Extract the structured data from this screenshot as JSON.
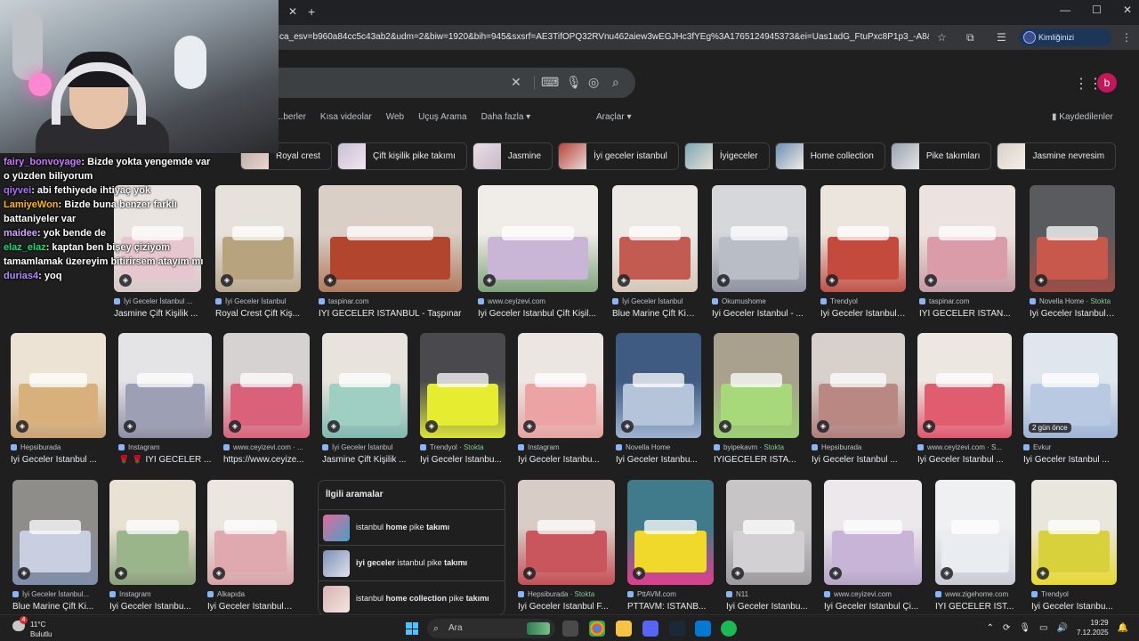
{
  "browser": {
    "url": "ca_esv=b960a84cc5c43ab2&udm=2&biw=1920&bih=945&sxsrf=AE3TifOPQ32RVnu462aiew3wEGJHc3fYEg%3A1765124945373&ei=Uas1adG_FtuPxc8P1p3_-A8&ved=0ahUKEw...",
    "profile_label": "Kimliğinizi doğrulayın",
    "window_controls": [
      "—",
      "☐",
      "✕"
    ]
  },
  "search": {
    "avatar_letter": "b"
  },
  "nav": {
    "tabs": [
      "...berler",
      "Kısa videolar",
      "Web",
      "Uçuş Arama",
      "Daha fazla ▾"
    ],
    "tools": "Araçlar ▾",
    "saved": "Kaydedilenler"
  },
  "chips": [
    "Royal crest",
    "Çift kişilik pike takımı",
    "Jasmine",
    "İyi geceler istanbul",
    "İyigeceler",
    "Home collection",
    "Pike takımları",
    "Jasmine nevresim"
  ],
  "row1": [
    {
      "src": "İyi Geceler İstanbul ...",
      "title": "Royal Crest Çift Kiş...",
      "c1": "#e8e6e3",
      "c2": "#c9b8a5",
      "bed": "#f2eee8"
    },
    {
      "src": "İyi Geceler İstanbul ...",
      "title": "Jasmine Çift Kişilik ...",
      "c1": "#e9e4e0",
      "c2": "#d8c9c9",
      "bed": "#e7c7cf"
    },
    {
      "src": "İyi Geceler İstanbul",
      "title": "Royal Crest Çift Kiş...",
      "c1": "#e6e1da",
      "c2": "#b9a98f",
      "bed": "#b7a37d"
    },
    {
      "src": "taspinar.com",
      "title": "İYİ GECELER İSTANBUL - Taşpınar",
      "c1": "#d9cfc6",
      "c2": "#b27a5e",
      "bed": "#b2452e"
    },
    {
      "src": "www.ceyizevi.com",
      "title": "İyi Geceler İstanbul Çift Kişil...",
      "c1": "#f0ece8",
      "c2": "#7da37a",
      "bed": "#c9b6d6"
    },
    {
      "src": "İyi Geceler İstanbul",
      "title": "Blue Marine Çift Kiş...",
      "c1": "#ece8e4",
      "c2": "#d6c7b8",
      "bed": "#c25b52"
    },
    {
      "src": "Okumushome",
      "title": "İyi Geceler İstanbul - ...",
      "c1": "#d5d7db",
      "c2": "#8f93a0",
      "bed": "#b9bdc6"
    },
    {
      "src": "Trendyol",
      "title": "İyi Geceler İstanbul ...",
      "c1": "#ebe5dd",
      "c2": "#c0524a",
      "bed": "#c44a3d"
    },
    {
      "src": "taspinar.com",
      "title": "İYİ GECELER İSTAN...",
      "c1": "#ece3e0",
      "c2": "#c69aa3",
      "bed": "#d99ca8"
    },
    {
      "src": "Novella Home · ",
      "stock": "Stokta",
      "title": "İyi Geceler İstanbul ...",
      "c1": "#5a5b5e",
      "c2": "#9c4e47",
      "bed": "#c8574c"
    }
  ],
  "row2": [
    {
      "src": "Hepsiburada",
      "title": "İyi Geceler İstanbul ...",
      "c1": "#ede3d4",
      "c2": "#caa273",
      "bed": "#d7b07c"
    },
    {
      "src": "Instagram",
      "title": "🌹 🌹 İYİ GECELER ...",
      "c1": "#e4e3e6",
      "c2": "#8e8fa3",
      "bed": "#9d9fb5"
    },
    {
      "src": "www.ceyizevi.com · ...",
      "title": "https://www.ceyize...",
      "c1": "#d6d2d2",
      "c2": "#d9647a",
      "bed": "#d9617a"
    },
    {
      "src": "İyi Geceler İstanbul",
      "title": "Jasmine Çift Kişilik ...",
      "c1": "#e8e3dd",
      "c2": "#7fb8b0",
      "bed": "#9fcfc3"
    },
    {
      "src": "Trendyol · ",
      "stock": "Stokta",
      "title": "İyi Geceler İstanbu...",
      "c1": "#4a4a4e",
      "c2": "#d9e43a",
      "bed": "#e6ec2f"
    },
    {
      "src": "Instagram",
      "title": "İyi Geceler İstanbu...",
      "c1": "#ece6e2",
      "c2": "#e6a3a0",
      "bed": "#eba4a3"
    },
    {
      "src": "Novella Home",
      "title": "İyi Geceler İstanbu...",
      "c1": "#3f5b82",
      "c2": "#9fb3cf",
      "bed": "#b6c4da"
    },
    {
      "src": "byipekavm · ",
      "stock": "Stokta",
      "title": "İYİGECELER İSTA...",
      "c1": "#a9a08d",
      "c2": "#9ccf74",
      "bed": "#a7d97b"
    },
    {
      "src": "Hepsiburada",
      "title": "İyi Geceler İstanbul ...",
      "c1": "#d8d0ca",
      "c2": "#b07f7a",
      "bed": "#b98883"
    },
    {
      "src": "www.ceyizevi.com · S...",
      "title": "İyi Geceler İstanbul ...",
      "c1": "#ece8e1",
      "c2": "#e0586e",
      "bed": "#df5d6f"
    },
    {
      "src": "Evkur",
      "title": "İyi Geceler İstanbul ...",
      "badge": "2 gün önce",
      "c1": "#dfe6ee",
      "c2": "#9fb4d4",
      "bed": "#b9c9e2"
    }
  ],
  "row3": [
    {
      "src": "İyi Geceler İstanbul...",
      "title": "Blue Marine Çift Ki...",
      "c1": "#8f8d8a",
      "c2": "#7f8eaa",
      "bed": "#c9cfe0"
    },
    {
      "src": "Instagram",
      "title": "İyi Geceler İstanbu...",
      "c1": "#e9e1d3",
      "c2": "#8aa07a",
      "bed": "#9ab58a"
    },
    {
      "src": "Alkapıda",
      "title": "İyi Geceler İstanbul Çi...",
      "c1": "#ebe6e0",
      "c2": "#d7a3a8",
      "bed": "#e0a9b0"
    },
    {
      "src": "Hepsiburada · ",
      "stock": "Stokta",
      "title": "İyi Geceler İstanbul F...",
      "c1": "#d8cdc6",
      "c2": "#c44f57",
      "bed": "#c8565c"
    },
    {
      "src": "PttAVM.com",
      "title": "PTTAVM: İSTANB...",
      "c1": "#3f7b8a",
      "c2": "#e03f8d",
      "bed": "#f0d92a"
    },
    {
      "src": "N11",
      "title": "İyi Geceler İstanbu...",
      "c1": "#c7c5c6",
      "c2": "#9e9b9f",
      "bed": "#d2d0d2"
    },
    {
      "src": "www.ceyizevi.com",
      "title": "İyi Geceler İstanbul Çi...",
      "c1": "#ece8ec",
      "c2": "#b7a4c9",
      "bed": "#c8b4d6"
    },
    {
      "src": "www.zigehome.com",
      "title": "İYİ GECELER İST...",
      "c1": "#eef0f2",
      "c2": "#c9ccd3",
      "bed": "#e9ecf0"
    },
    {
      "src": "Trendyol",
      "title": "İyi Geceler İstanbu...",
      "c1": "#e9e6de",
      "c2": "#e8d82f",
      "bed": "#d9d13b"
    }
  ],
  "related": {
    "title": "İlgili aramalar",
    "items": [
      {
        "pre": "istanbul ",
        "b1": "home",
        "mid": " pike ",
        "b2": "takımı",
        "post": ""
      },
      {
        "pre": "",
        "b1": "iyi geceler",
        "mid": " istanbul pike ",
        "b2": "takımı",
        "post": ""
      },
      {
        "pre": "istanbul ",
        "b1": "home collection",
        "mid": " pike ",
        "b2": "takımı",
        "post": ""
      }
    ]
  },
  "chat": [
    {
      "user": "fairy_bonvoyage",
      "msg": ": Bizde yokta yengemde var o yüzden biliyorum"
    },
    {
      "user": "qiyvei",
      "msg": ": abi fethiyede ihtiyaç yok"
    },
    {
      "user": "LamiyeWon",
      "msg": ": Bizde buna benzer farklı battaniyeler var"
    },
    {
      "user": "maidee",
      "msg": ": yok bende de"
    },
    {
      "user": "elaz_elaz",
      "msg": ": kaptan ben bişey çiziyom tamamlamak üzereyim bitirirsem atayım mı"
    },
    {
      "user": "durias4",
      "msg": ": yoq"
    }
  ],
  "taskbar": {
    "temp": "11°C",
    "weather": "Bulutlu",
    "weather_badge": "4",
    "search_placeholder": "Ara",
    "time": "19:29",
    "date": "7.12.2025"
  }
}
